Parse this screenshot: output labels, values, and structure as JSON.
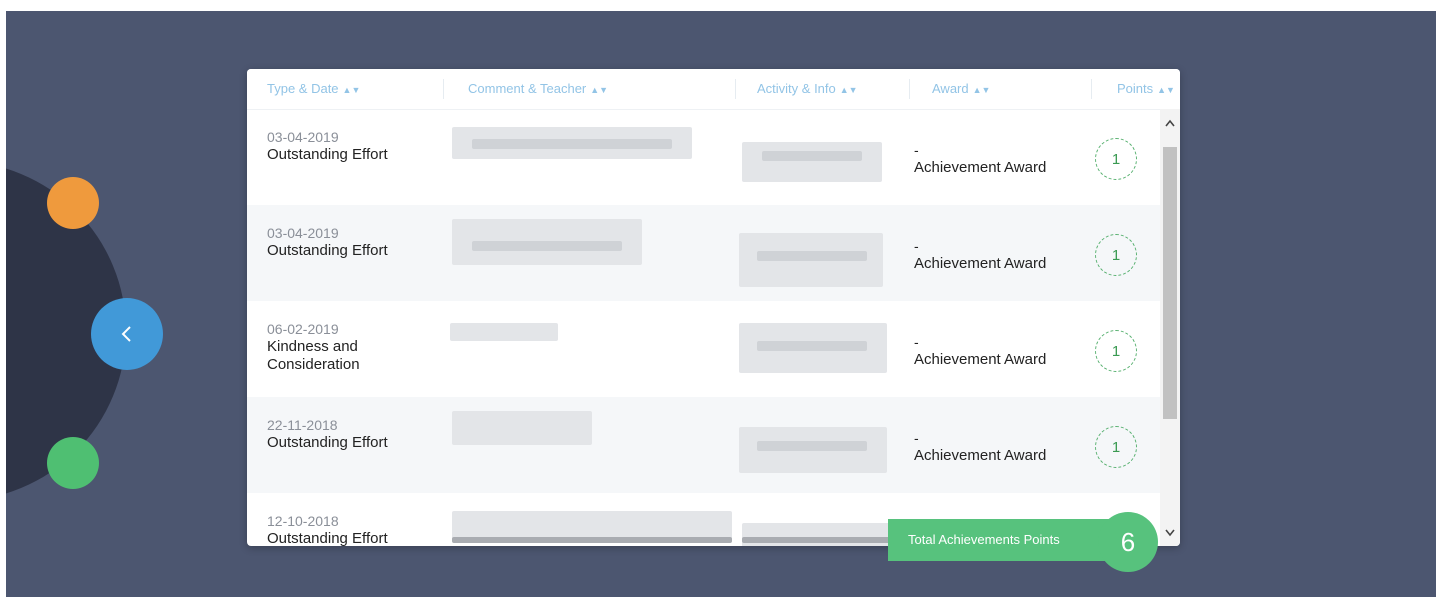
{
  "table": {
    "headers": [
      {
        "label": "Type & Date",
        "sort_icon": "sort-icon"
      },
      {
        "label": "Comment & Teacher",
        "sort_icon": "sort-icon"
      },
      {
        "label": "Activity & Info",
        "sort_icon": "sort-icon"
      },
      {
        "label": "Award",
        "sort_icon": "sort-icon"
      },
      {
        "label": "Points",
        "sort_icon": "sort-icon"
      }
    ],
    "rows": [
      {
        "date": "03-04-2019",
        "type": "Outstanding Effort",
        "award_prefix": "-",
        "award": "Achievement Award",
        "points": "1"
      },
      {
        "date": "03-04-2019",
        "type": "Outstanding Effort",
        "award_prefix": "-",
        "award": "Achievement Award",
        "points": "1"
      },
      {
        "date": "06-02-2019",
        "type": "Kindness and Consideration",
        "award_prefix": "-",
        "award": "Achievement Award",
        "points": "1"
      },
      {
        "date": "22-11-2018",
        "type": "Outstanding Effort",
        "award_prefix": "-",
        "award": "Achievement Award",
        "points": "1"
      },
      {
        "date": "12-10-2018",
        "type": "Outstanding Effort",
        "award_prefix": "",
        "award": "",
        "points": ""
      }
    ]
  },
  "summary": {
    "total_label": "Total Achievements Points",
    "total_value": "6"
  },
  "side_nav": {
    "back_icon": "chevron-left-icon"
  },
  "colors": {
    "background": "#4c5670",
    "header_text": "#92c4e6",
    "accent_green": "#57c27d",
    "accent_blue": "#4199d8",
    "accent_orange": "#ef9a3d"
  }
}
